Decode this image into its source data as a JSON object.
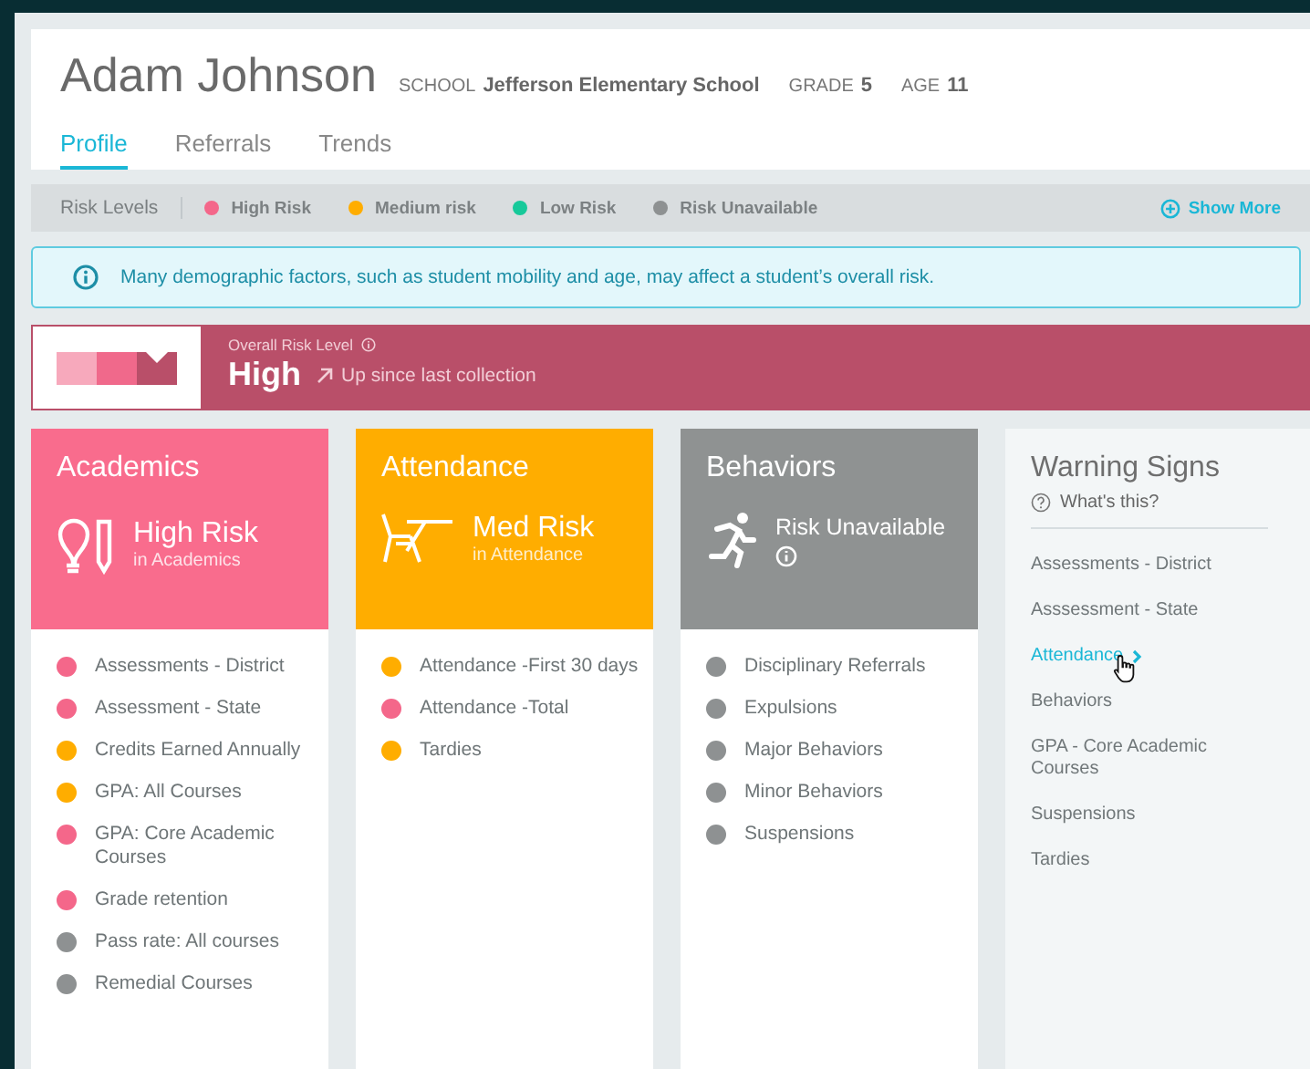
{
  "student": {
    "name": "Adam Johnson",
    "school_label": "SCHOOL",
    "school": "Jefferson Elementary School",
    "grade_label": "GRADE",
    "grade": "5",
    "age_label": "AGE",
    "age": "11"
  },
  "tabs": [
    {
      "label": "Profile",
      "selected": true
    },
    {
      "label": "Referrals",
      "selected": false
    },
    {
      "label": "Trends",
      "selected": false
    }
  ],
  "legend": {
    "title": "Risk Levels",
    "items": [
      {
        "label": "High Risk",
        "color": "#f4678a"
      },
      {
        "label": "Medium risk",
        "color": "#ffad00"
      },
      {
        "label": "Low Risk",
        "color": "#17c99a"
      },
      {
        "label": "Risk Unavailable",
        "color": "#8e9192"
      }
    ],
    "action": "Show More"
  },
  "notice": "Many demographic factors, such as student mobility and age, may affect a student’s overall risk.",
  "overall": {
    "label": "Overall Risk Level",
    "level": "High",
    "trend": "Up since last collection"
  },
  "risk_cards": [
    {
      "title": "Academics",
      "kind": "academics",
      "color": "#f96c8d",
      "risk": "High Risk",
      "sub": "in Academics",
      "info": false,
      "items": [
        {
          "label": "Assessments - District",
          "color": "#f4678a"
        },
        {
          "label": "Assessment - State",
          "color": "#f4678a"
        },
        {
          "label": "Credits Earned Annually",
          "color": "#ffad00"
        },
        {
          "label": "GPA: All Courses",
          "color": "#ffad00"
        },
        {
          "label": "GPA: Core Academic Courses",
          "color": "#f4678a"
        },
        {
          "label": "Grade retention",
          "color": "#f4678a"
        },
        {
          "label": "Pass rate: All courses",
          "color": "#8e9192"
        },
        {
          "label": "Remedial Courses",
          "color": "#8e9192"
        }
      ]
    },
    {
      "title": "Attendance",
      "kind": "attendance",
      "color": "#ffad00",
      "risk": "Med Risk",
      "sub": "in Attendance",
      "info": false,
      "items": [
        {
          "label": "Attendance -First 30 days",
          "color": "#ffad00"
        },
        {
          "label": "Attendance -Total",
          "color": "#f4678a"
        },
        {
          "label": "Tardies",
          "color": "#ffad00"
        }
      ]
    },
    {
      "title": "Behaviors",
      "kind": "behaviors",
      "color": "#8f9292",
      "risk": "Risk Unavailable",
      "info": true,
      "items": [
        {
          "label": "Disciplinary Referrals",
          "color": "#8e9192"
        },
        {
          "label": "Expulsions",
          "color": "#8e9192"
        },
        {
          "label": "Major Behaviors",
          "color": "#8e9192"
        },
        {
          "label": "Minor Behaviors",
          "color": "#8e9192"
        },
        {
          "label": "Suspensions",
          "color": "#8e9192"
        }
      ]
    }
  ],
  "warning_signs": {
    "title": "Warning Signs",
    "help": "What's this?",
    "items": [
      {
        "label": "Assessments - District",
        "selected": false
      },
      {
        "label": "Asssessment - State",
        "selected": false
      },
      {
        "label": "Attendance",
        "selected": true
      },
      {
        "label": "Behaviors",
        "selected": false
      },
      {
        "label": "GPA - Core Academic Courses",
        "selected": false
      },
      {
        "label": "Suspensions",
        "selected": false
      },
      {
        "label": "Tardies",
        "selected": false
      }
    ]
  }
}
